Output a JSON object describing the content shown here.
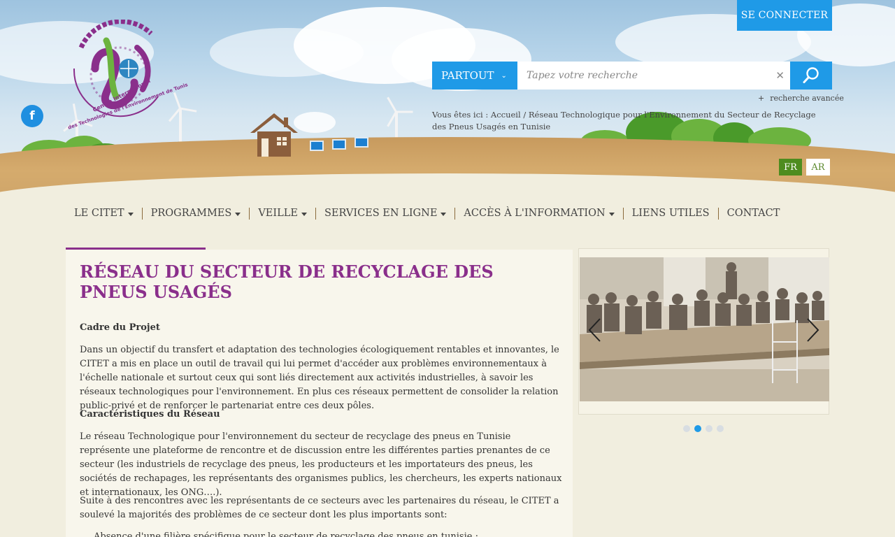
{
  "header": {
    "login_label": "SE CONNECTER",
    "search": {
      "scope_label": "PARTOUT",
      "placeholder": "Tapez votre recherche",
      "advanced_label": "recherche avancée"
    },
    "breadcrumb": "Vous êtes ici :  Accueil / Réseau Technologique pour l'Environnement du Secteur de Recyclage des Pneus Usagés en Tunisie",
    "languages": [
      "FR",
      "AR"
    ],
    "logo_text": {
      "fr_line1": "Centre International",
      "fr_line2": "des Technologies de l'Environnement de Tunis"
    }
  },
  "nav": {
    "items": [
      {
        "label": "LE CITET",
        "dropdown": true
      },
      {
        "label": "PROGRAMMES",
        "dropdown": true
      },
      {
        "label": "VEILLE",
        "dropdown": true
      },
      {
        "label": "SERVICES EN LIGNE",
        "dropdown": true
      },
      {
        "label": "ACCÈS À L'INFORMATION",
        "dropdown": true
      },
      {
        "label": "LIENS UTILES",
        "dropdown": false
      },
      {
        "label": "CONTACT",
        "dropdown": false
      }
    ]
  },
  "article": {
    "title": "RÉSEAU DU SECTEUR DE RECYCLAGE DES PNEUS USAGÉS",
    "section1_title": "Cadre du Projet",
    "section1_text": "Dans un objectif du transfert et adaptation des technologies écologiquement rentables et innovantes, le CITET a mis en place un outil de travail qui lui permet d'accéder aux problèmes environnementaux à l'échelle nationale et surtout ceux qui sont liés directement aux activités industrielles, à savoir les réseaux technologiques pour l'environnement. En plus ces réseaux permettent de consolider la relation public-privé et de renforcer le partenariat entre ces deux pôles.",
    "section2_title": "Caractéristiques du Réseau",
    "section2_text": "Le réseau Technologique pour l'environnement du secteur de recyclage des pneus en Tunisie représente une plateforme de rencontre et de discussion entre les différentes parties prenantes de ce secteur (les industriels de recyclage des pneus, les producteurs et les importateurs des pneus, les sociétés de rechapages, les représentants des organismes publics, les chercheurs, les experts nationaux et internationaux, les ONG….).",
    "section3_text": "Suite à des rencontres avec les représentants de ce secteurs avec les partenaires du réseau, le CITET a soulevé la majorités des problèmes de ce secteur dont les plus importants sont:",
    "bullet1": "Absence d'une filière spécifique pour le secteur de recyclage des pneus en tunisie ;"
  },
  "slider": {
    "slide_count": 4,
    "active_index": 1
  },
  "colors": {
    "accent_blue": "#1f9ae7",
    "title_purple": "#8a2f8b",
    "lang_green": "#4e8c1f"
  }
}
